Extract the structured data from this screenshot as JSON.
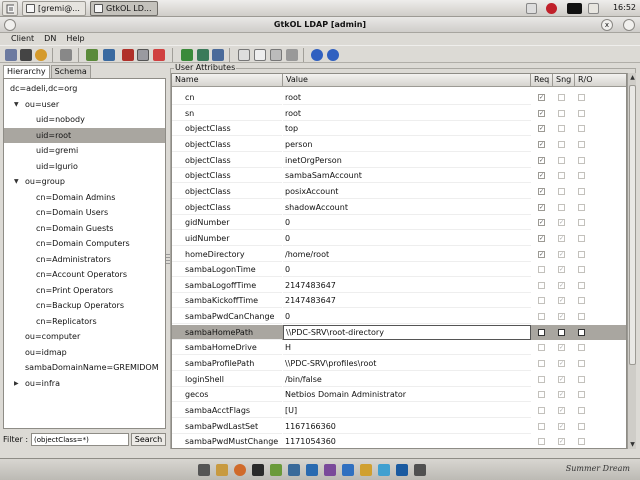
{
  "top_panel": {
    "tasks": [
      {
        "label": "[gremi@...",
        "active": false
      },
      {
        "label": "GtkOL LD...",
        "active": true
      }
    ],
    "clock": "16:52"
  },
  "window": {
    "title": "GtkOL LDAP [admin]",
    "close_glyph": "x"
  },
  "menu": [
    "Client",
    "DN",
    "Help"
  ],
  "left_panel": {
    "tabs": [
      "Hierarchy",
      "Schema"
    ],
    "tree": [
      {
        "label": "dc=adeli,dc=org",
        "level": 0,
        "expander": "none",
        "selected": false
      },
      {
        "label": "ou=user",
        "level": 1,
        "expander": "open",
        "selected": false
      },
      {
        "label": "uid=nobody",
        "level": 2,
        "expander": "none",
        "selected": false
      },
      {
        "label": "uid=root",
        "level": 2,
        "expander": "none",
        "selected": true
      },
      {
        "label": "uid=gremi",
        "level": 2,
        "expander": "none",
        "selected": false
      },
      {
        "label": "uid=lgurio",
        "level": 2,
        "expander": "none",
        "selected": false
      },
      {
        "label": "ou=group",
        "level": 1,
        "expander": "open",
        "selected": false
      },
      {
        "label": "cn=Domain Admins",
        "level": 2,
        "expander": "none",
        "selected": false
      },
      {
        "label": "cn=Domain Users",
        "level": 2,
        "expander": "none",
        "selected": false
      },
      {
        "label": "cn=Domain Guests",
        "level": 2,
        "expander": "none",
        "selected": false
      },
      {
        "label": "cn=Domain Computers",
        "level": 2,
        "expander": "none",
        "selected": false
      },
      {
        "label": "cn=Administrators",
        "level": 2,
        "expander": "none",
        "selected": false
      },
      {
        "label": "cn=Account Operators",
        "level": 2,
        "expander": "none",
        "selected": false
      },
      {
        "label": "cn=Print Operators",
        "level": 2,
        "expander": "none",
        "selected": false
      },
      {
        "label": "cn=Backup Operators",
        "level": 2,
        "expander": "none",
        "selected": false
      },
      {
        "label": "cn=Replicators",
        "level": 2,
        "expander": "none",
        "selected": false
      },
      {
        "label": "ou=computer",
        "level": 1,
        "expander": "none",
        "selected": false
      },
      {
        "label": "ou=idmap",
        "level": 1,
        "expander": "none",
        "selected": false
      },
      {
        "label": "sambaDomainName=GREMIDOM",
        "level": 1,
        "expander": "none",
        "selected": false
      },
      {
        "label": "ou=infra",
        "level": 1,
        "expander": "closed",
        "selected": false
      }
    ],
    "filter_label": "Filter :",
    "filter_value": "(objectClass=*)",
    "search_label": "Search"
  },
  "attributes": {
    "frame_label": "User Attributes",
    "columns": [
      "Name",
      "Value",
      "Req",
      "Sng",
      "R/O"
    ],
    "rows": [
      {
        "name": "cn",
        "value": "root",
        "req": true,
        "sng": false,
        "ro": false,
        "selected": false
      },
      {
        "name": "sn",
        "value": "root",
        "req": true,
        "sng": false,
        "ro": false,
        "selected": false
      },
      {
        "name": "objectClass",
        "value": "top",
        "req": true,
        "sng": false,
        "ro": false,
        "selected": false
      },
      {
        "name": "objectClass",
        "value": "person",
        "req": true,
        "sng": false,
        "ro": false,
        "selected": false
      },
      {
        "name": "objectClass",
        "value": "inetOrgPerson",
        "req": true,
        "sng": false,
        "ro": false,
        "selected": false
      },
      {
        "name": "objectClass",
        "value": "sambaSamAccount",
        "req": true,
        "sng": false,
        "ro": false,
        "selected": false
      },
      {
        "name": "objectClass",
        "value": "posixAccount",
        "req": true,
        "sng": false,
        "ro": false,
        "selected": false
      },
      {
        "name": "objectClass",
        "value": "shadowAccount",
        "req": true,
        "sng": false,
        "ro": false,
        "selected": false
      },
      {
        "name": "gidNumber",
        "value": "0",
        "req": true,
        "sng": true,
        "ro": false,
        "selected": false
      },
      {
        "name": "uidNumber",
        "value": "0",
        "req": true,
        "sng": true,
        "ro": false,
        "selected": false
      },
      {
        "name": "homeDirectory",
        "value": "/home/root",
        "req": true,
        "sng": true,
        "ro": false,
        "selected": false
      },
      {
        "name": "sambaLogonTime",
        "value": "0",
        "req": false,
        "sng": true,
        "ro": false,
        "selected": false
      },
      {
        "name": "sambaLogoffTime",
        "value": "2147483647",
        "req": false,
        "sng": true,
        "ro": false,
        "selected": false
      },
      {
        "name": "sambaKickoffTime",
        "value": "2147483647",
        "req": false,
        "sng": true,
        "ro": false,
        "selected": false
      },
      {
        "name": "sambaPwdCanChange",
        "value": "0",
        "req": false,
        "sng": true,
        "ro": false,
        "selected": false
      },
      {
        "name": "sambaHomePath",
        "value": "\\\\PDC-SRV\\root-directory",
        "req": false,
        "sng": false,
        "ro": false,
        "selected": true
      },
      {
        "name": "sambaHomeDrive",
        "value": "H",
        "req": false,
        "sng": true,
        "ro": false,
        "selected": false
      },
      {
        "name": "sambaProfilePath",
        "value": "\\\\PDC-SRV\\profiles\\root",
        "req": false,
        "sng": true,
        "ro": false,
        "selected": false
      },
      {
        "name": "loginShell",
        "value": "/bin/false",
        "req": false,
        "sng": true,
        "ro": false,
        "selected": false
      },
      {
        "name": "gecos",
        "value": "Netbios Domain Administrator",
        "req": false,
        "sng": true,
        "ro": false,
        "selected": false
      },
      {
        "name": "sambaAcctFlags",
        "value": "[U]",
        "req": false,
        "sng": true,
        "ro": false,
        "selected": false
      },
      {
        "name": "sambaPwdLastSet",
        "value": "1167166360",
        "req": false,
        "sng": true,
        "ro": false,
        "selected": false
      },
      {
        "name": "sambaPwdMustChange",
        "value": "1171054360",
        "req": false,
        "sng": true,
        "ro": false,
        "selected": false
      }
    ]
  },
  "bottom_panel": {
    "signature": "Summer Dream"
  },
  "colors": {
    "selection": "#a9a6a0",
    "panel": "#dcdad5"
  }
}
